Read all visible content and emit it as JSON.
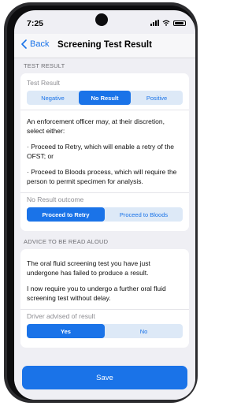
{
  "status_bar": {
    "time": "7:25"
  },
  "nav": {
    "back_label": "Back",
    "title": "Screening Test Result"
  },
  "test_result": {
    "section_header": "TEST RESULT",
    "field_label": "Test Result",
    "options": [
      "Negative",
      "No Result",
      "Positive"
    ],
    "selected": "No Result",
    "paragraphs": [
      "An enforcement officer may, at their discretion, select either:",
      "· Proceed to Retry, which will enable a retry of the OFST; or",
      "· Proceed to Bloods process, which will require the person to permit specimen for analysis."
    ],
    "outcome_label": "No Result outcome",
    "outcome_options": [
      "Proceed to Retry",
      "Proceed to Bloods"
    ],
    "outcome_selected": "Proceed to Retry"
  },
  "advice": {
    "section_header": "ADVICE TO BE READ ALOUD",
    "paragraphs": [
      "The oral fluid screening test you have just undergone has failed to produce a result.",
      "I now require you to undergo a further oral fluid screening test without delay."
    ],
    "driver_label": "Driver advised of result",
    "driver_options": [
      "Yes",
      "No"
    ],
    "driver_selected": "Yes"
  },
  "footer": {
    "save_label": "Save"
  },
  "colors": {
    "accent": "#1a73e8",
    "background": "#efeff4"
  }
}
